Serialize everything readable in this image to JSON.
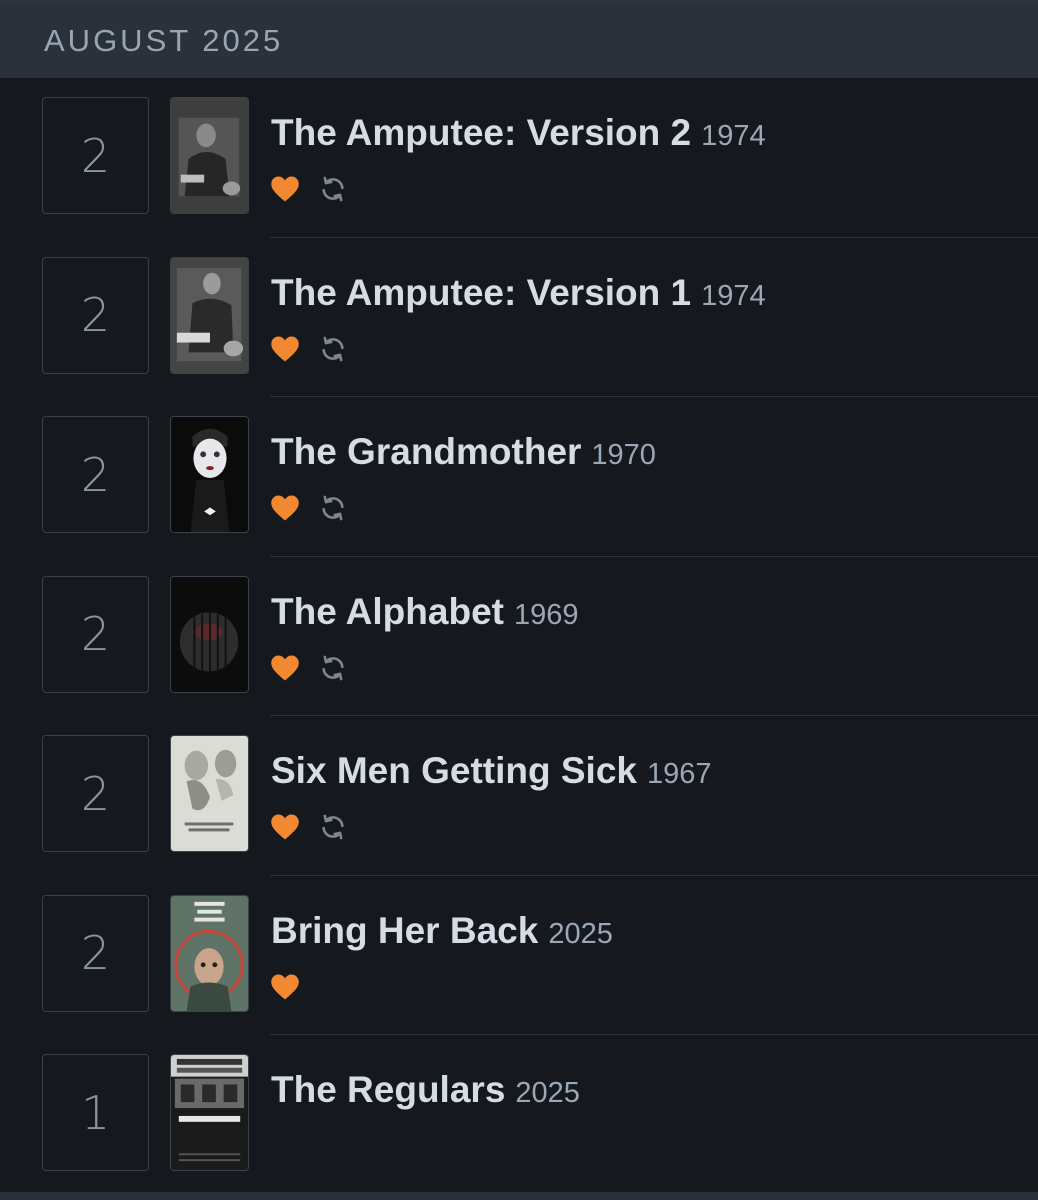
{
  "header": {
    "month": "AUGUST 2025"
  },
  "colors": {
    "like": "#f2882f",
    "rewatch": "#7a8795",
    "text": "#d4dde6"
  },
  "entries": [
    {
      "day": "2",
      "title": "The Amputee: Version 2",
      "year": "1974",
      "liked": true,
      "rewatch": true
    },
    {
      "day": "2",
      "title": "The Amputee: Version 1",
      "year": "1974",
      "liked": true,
      "rewatch": true
    },
    {
      "day": "2",
      "title": "The Grandmother",
      "year": "1970",
      "liked": true,
      "rewatch": true
    },
    {
      "day": "2",
      "title": "The Alphabet",
      "year": "1969",
      "liked": true,
      "rewatch": true
    },
    {
      "day": "2",
      "title": "Six Men Getting Sick",
      "year": "1967",
      "liked": true,
      "rewatch": true
    },
    {
      "day": "2",
      "title": "Bring Her Back",
      "year": "2025",
      "liked": true,
      "rewatch": false
    },
    {
      "day": "1",
      "title": "The Regulars",
      "year": "2025",
      "liked": false,
      "rewatch": false
    }
  ]
}
